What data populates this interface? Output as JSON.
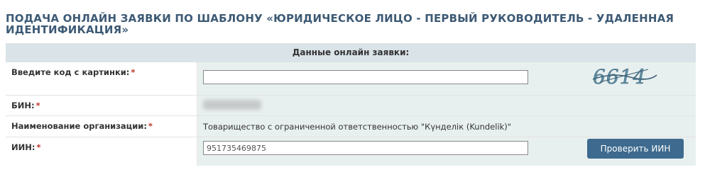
{
  "page": {
    "title": "ПОДАЧА ОНЛАЙН ЗАЯВКИ ПО ШАБЛОНУ «ЮРИДИЧЕСКОЕ ЛИЦО - ПЕРВЫЙ РУКОВОДИТЕЛЬ - УДАЛЕННАЯ ИДЕНТИФИКАЦИЯ»"
  },
  "form": {
    "header": "Данные онлайн заявки:",
    "required_mark": "*",
    "captcha": {
      "label": "Введите код с картинки:",
      "value": "",
      "image_text": "6614"
    },
    "bin": {
      "label": "БИН:"
    },
    "organization": {
      "label": "Наименование организации:",
      "value": "Товарищество с ограниченной ответственностью \"Күнделік (Kundelik)\""
    },
    "iin": {
      "label": "ИИН:",
      "value": "951735469875",
      "button_label": "Проверить ИИН"
    }
  },
  "colors": {
    "title": "#3d5a75",
    "header_bg": "#d9e3e8",
    "value_bg": "#e8f0ef",
    "button_bg": "#3d6a8e",
    "required": "#c0392b"
  }
}
